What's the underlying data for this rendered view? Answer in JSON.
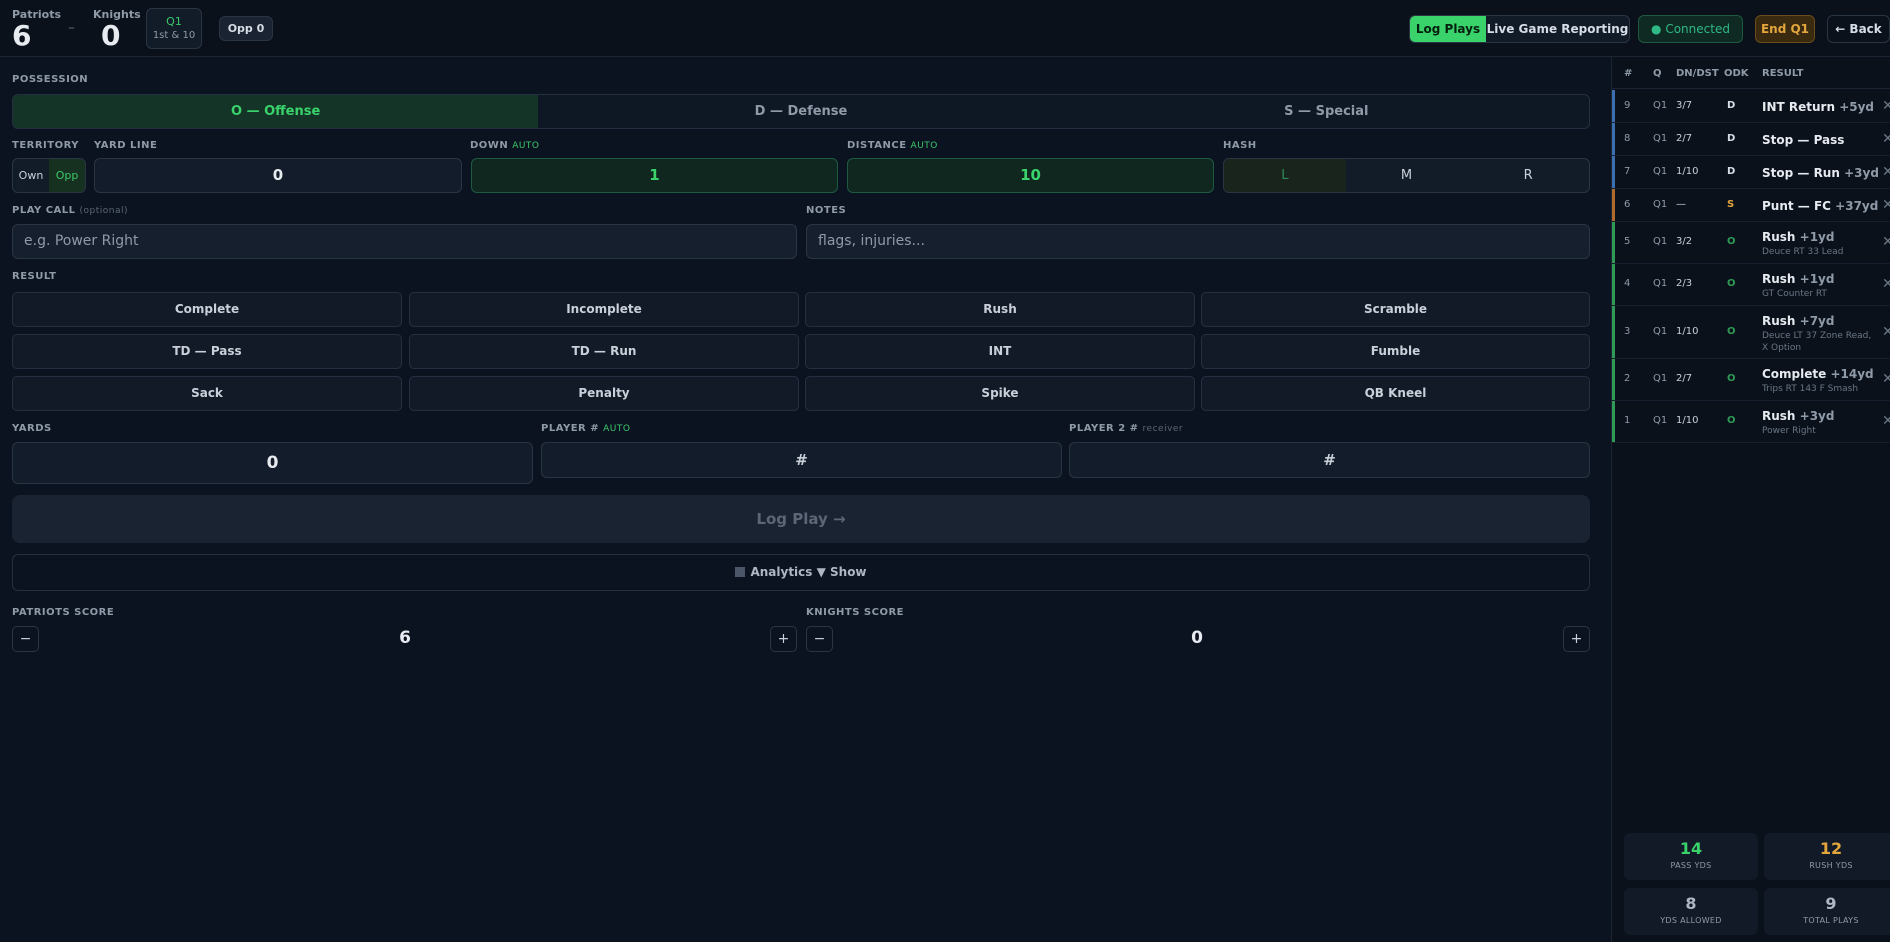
{
  "scoreboard": {
    "home_name": "Patriots",
    "home_score": "6",
    "away_name": "Knights",
    "away_score": "0",
    "separator": "–",
    "quarter": "Q1",
    "down_distance": "1st & 10",
    "opp_label": "Opp 0"
  },
  "header": {
    "mode_log": "Log Plays",
    "mode_live": "Live Game Reporting",
    "connected": "● Connected",
    "end_quarter": "End Q1",
    "back": "← Back"
  },
  "possession": {
    "label": "POSSESSION",
    "options": [
      "O — Offense",
      "D — Defense",
      "S — Special"
    ],
    "selected": "O — Offense"
  },
  "fields": {
    "territory_label": "TERRITORY",
    "territory_own": "Own",
    "territory_opp": "Opp",
    "yard_line_label": "YARD LINE",
    "yard_line": "0",
    "down_label": "DOWN",
    "down_auto": "AUTO",
    "down": "1",
    "distance_label": "DISTANCE",
    "distance_auto": "AUTO",
    "distance": "10",
    "hash_label": "HASH",
    "hash_options": [
      "L",
      "M",
      "R"
    ],
    "play_call_label": "PLAY CALL",
    "play_call_optional": "(optional)",
    "play_call_placeholder": "e.g. Power Right",
    "notes_label": "NOTES",
    "notes_placeholder": "flags, injuries..."
  },
  "result": {
    "label": "RESULT",
    "buttons": [
      "Complete",
      "Incomplete",
      "Rush",
      "Scramble",
      "TD — Pass",
      "TD — Run",
      "INT",
      "Fumble",
      "Sack",
      "Penalty",
      "Spike",
      "QB Kneel"
    ]
  },
  "players": {
    "yards_label": "YARDS",
    "yards": "0",
    "player_label": "PLAYER #",
    "player_auto": "AUTO",
    "player_placeholder": "#",
    "player2_label": "PLAYER 2 #",
    "player2_sub": "receiver",
    "player2_placeholder": "#"
  },
  "actions": {
    "log_play": "Log Play →",
    "analytics": "Analytics ▼ Show"
  },
  "scores": {
    "home_label": "PATRIOTS SCORE",
    "home_value": "6",
    "away_label": "KNIGHTS SCORE",
    "away_value": "0",
    "minus": "−",
    "plus": "+"
  },
  "play_log": {
    "headers": [
      "#",
      "Q",
      "DN/DST",
      "ODK",
      "RESULT"
    ],
    "rows": [
      {
        "n": "9",
        "q": "Q1",
        "dd": "3/7",
        "odk": "D",
        "result": "INT Return",
        "gain": "+5yd",
        "call": "",
        "color": "#3b6fb0"
      },
      {
        "n": "8",
        "q": "Q1",
        "dd": "2/7",
        "odk": "D",
        "result": "Stop — Pass",
        "gain": "",
        "call": "",
        "color": "#3b6fb0"
      },
      {
        "n": "7",
        "q": "Q1",
        "dd": "1/10",
        "odk": "D",
        "result": "Stop — Run",
        "gain": "+3yd",
        "call": "",
        "color": "#3b6fb0"
      },
      {
        "n": "6",
        "q": "Q1",
        "dd": "—",
        "odk": "S",
        "result": "Punt — FC",
        "gain": "+37yd",
        "call": "",
        "color": "#b06a2b"
      },
      {
        "n": "5",
        "q": "Q1",
        "dd": "3/2",
        "odk": "O",
        "result": "Rush",
        "gain": "+1yd",
        "call": "Deuce RT 33 Lead",
        "color": "#2f9a55"
      },
      {
        "n": "4",
        "q": "Q1",
        "dd": "2/3",
        "odk": "O",
        "result": "Rush",
        "gain": "+1yd",
        "call": "GT Counter RT",
        "color": "#2f9a55"
      },
      {
        "n": "3",
        "q": "Q1",
        "dd": "1/10",
        "odk": "O",
        "result": "Rush",
        "gain": "+7yd",
        "call": "Deuce LT 37 Zone Read, X Option",
        "color": "#2f9a55"
      },
      {
        "n": "2",
        "q": "Q1",
        "dd": "2/7",
        "odk": "O",
        "result": "Complete",
        "gain": "+14yd",
        "call": "Trips RT 143 F Smash",
        "color": "#2f9a55"
      },
      {
        "n": "1",
        "q": "Q1",
        "dd": "1/10",
        "odk": "O",
        "result": "Rush",
        "gain": "+3yd",
        "call": "Power Right",
        "color": "#2f9a55"
      }
    ]
  },
  "stats": [
    {
      "value": "14",
      "label": "PASS YDS",
      "color": "#3ad36b"
    },
    {
      "value": "12",
      "label": "RUSH YDS",
      "color": "#e3a63d"
    },
    {
      "value": "8",
      "label": "YDS ALLOWED",
      "color": "#aeb7c3"
    },
    {
      "value": "9",
      "label": "TOTAL PLAYS",
      "color": "#aeb7c3"
    }
  ],
  "colors": {
    "accent": "#3ad36b",
    "offense": "#2f9a55",
    "defense": "#3b6fb0",
    "special": "#b06a2b",
    "warning": "#e3a63d"
  }
}
